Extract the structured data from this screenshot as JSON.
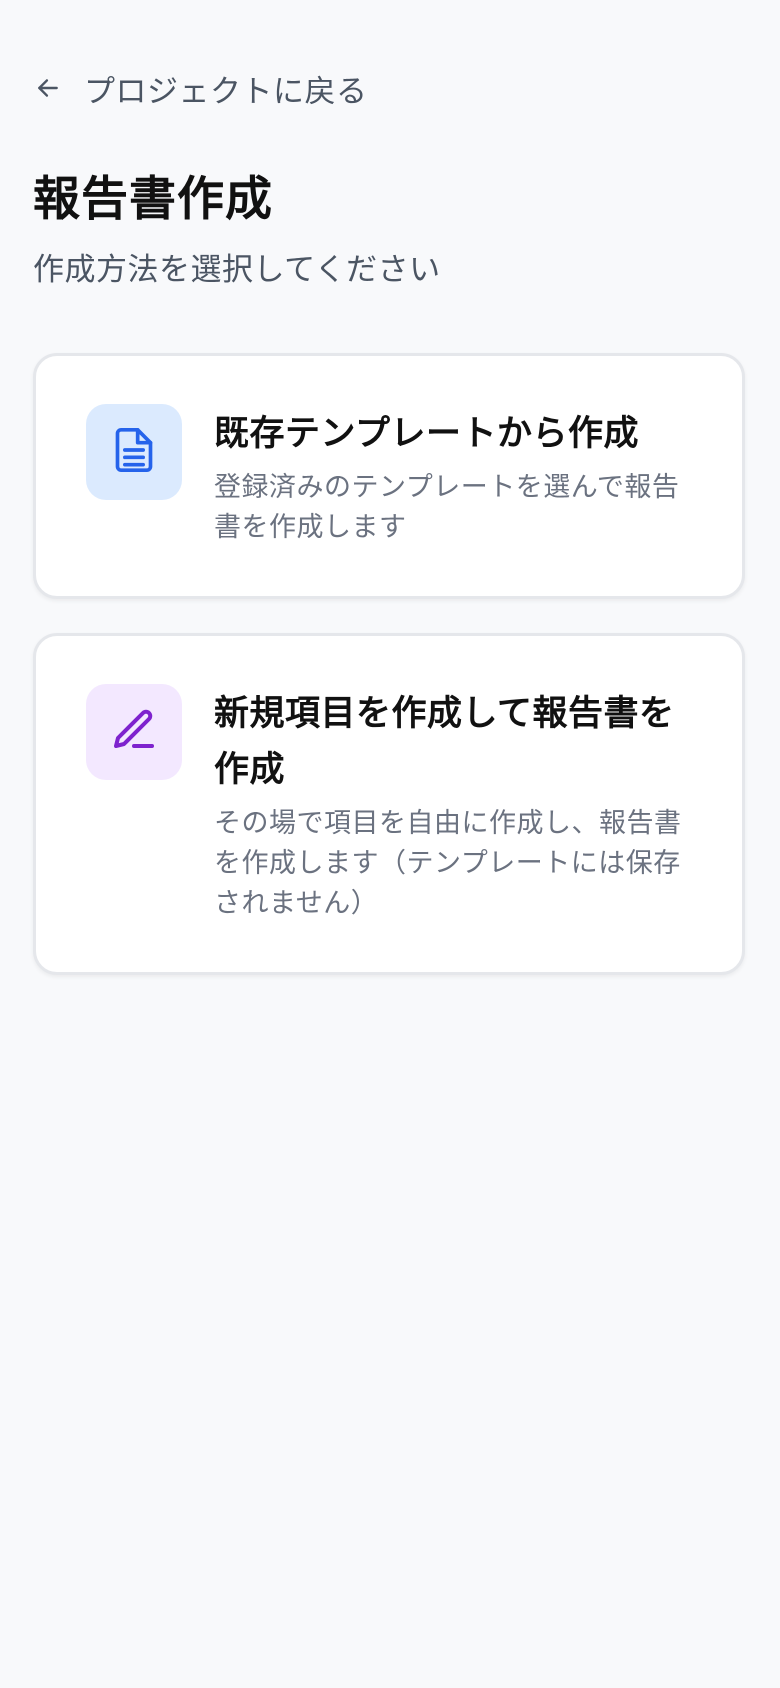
{
  "header": {
    "back_label": "プロジェクトに戻る",
    "back_icon": "arrow-left-icon"
  },
  "page": {
    "title": "報告書作成",
    "subtitle": "作成方法を選択してください"
  },
  "options": [
    {
      "title": "既存テンプレートから作成",
      "description": "登録済みのテンプレートを選んで報告書を作成します",
      "icon": "document-icon",
      "icon_color": "#2563eb",
      "icon_bg": "#dbeafe"
    },
    {
      "title": "新規項目を作成して報告書を作成",
      "description": "その場で項目を自由に作成し、報告書を作成します（テンプレートには保存されません）",
      "icon": "pencil-icon",
      "icon_color": "#7e22ce",
      "icon_bg": "#f3e8ff"
    }
  ]
}
